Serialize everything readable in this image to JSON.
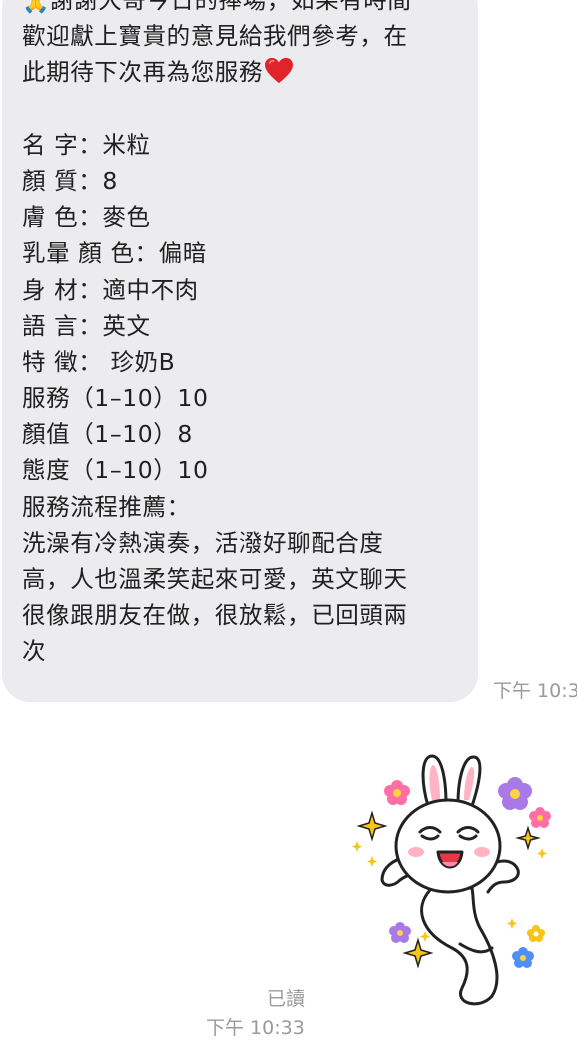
{
  "message": {
    "prefix_emoji": "🙏",
    "lines": [
      "謝謝大哥今日的捧場，如果有時間",
      "歡迎獻上寶貴的意見給我們參考，在",
      "此期待下次再為您服務",
      "",
      "名 字：米粒",
      "顏 質：8",
      "膚 色：麥色",
      "乳暈 顏 色：偏暗",
      "身 材：適中不肉",
      "語 言：英文",
      "特 徵： 珍奶B",
      "服務（1–10）10",
      "顏值（1–10）8",
      "態度（1–10）10",
      "服務流程推薦：",
      "洗澡有冷熱演奏，活潑好聊配合度",
      "高，人也溫柔笑起來可愛，英文聊天",
      "很像跟朋友在做，很放鬆，已回頭兩",
      "次"
    ],
    "heart_icon": "red-heart-icon",
    "time": "下午 10:3"
  },
  "sticker": {
    "icon": "bunny-sticker-icon",
    "read_status": "已讀",
    "time": "下午 10:33"
  },
  "colors": {
    "bubble_bg": "#ececee",
    "text": "#202020",
    "meta_text": "#9a9a9a",
    "heart": "#e0242b"
  }
}
